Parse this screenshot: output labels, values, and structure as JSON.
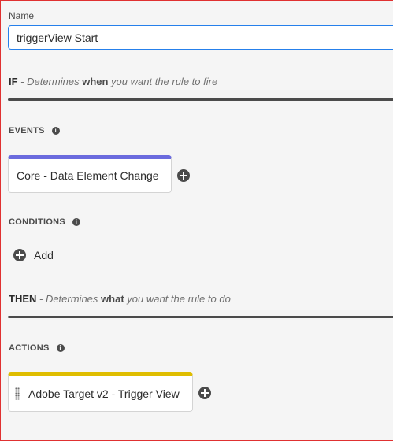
{
  "name_field": {
    "label": "Name",
    "value": "triggerView Start"
  },
  "if_section": {
    "keyword": "IF",
    "prefix": " - Determines ",
    "emphasis": "when",
    "suffix": " you want the rule to fire"
  },
  "events": {
    "label": "EVENTS",
    "info_icon": "info-icon",
    "card_label": "Core - Data Element Change",
    "accent": "#6b6bde"
  },
  "conditions": {
    "label": "CONDITIONS",
    "info_icon": "info-icon",
    "add_label": "Add"
  },
  "then_section": {
    "keyword": "THEN",
    "prefix": " - Determines ",
    "emphasis": "what",
    "suffix": " you want the rule to do"
  },
  "actions": {
    "label": "ACTIONS",
    "info_icon": "info-icon",
    "card_label": "Adobe Target v2 - Trigger View",
    "accent": "#dfbd00"
  },
  "colors": {
    "input_focus_border": "#2680eb",
    "frame_border": "#e03131",
    "background": "#f5f5f5"
  }
}
